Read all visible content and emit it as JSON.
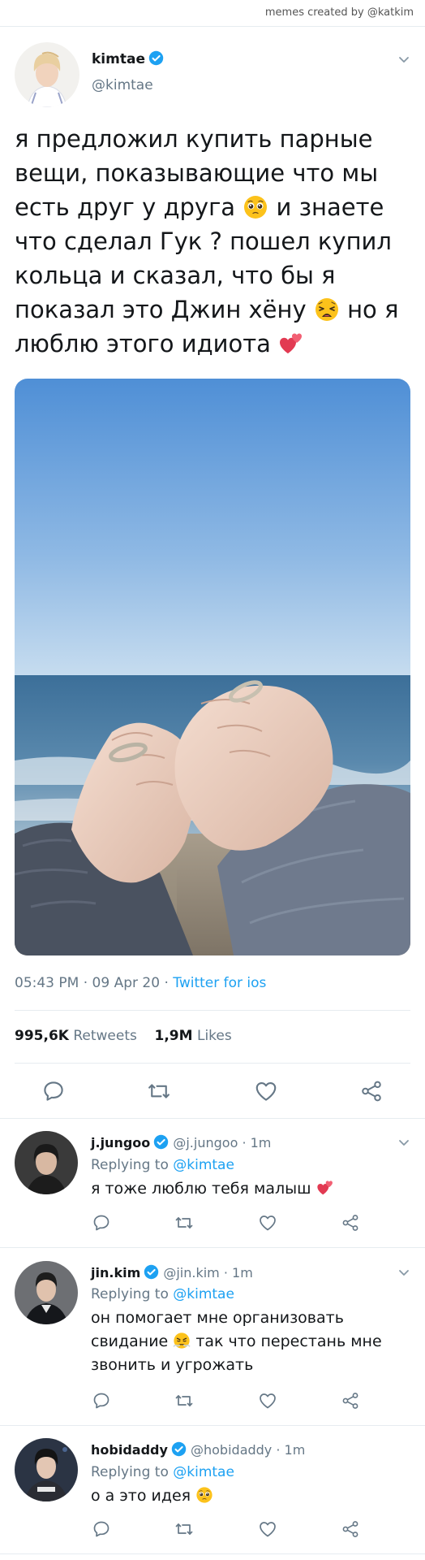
{
  "watermark": "memes created by @katkim",
  "main_tweet": {
    "name": "kimtae",
    "handle": "@kimtae",
    "text_part1": "я предложил купить парные вещи, показывающие что мы есть друг у друга",
    "text_part2": "и знаете что сделал Гук ? пошел купил кольца и сказал, что бы я показал это Джин хёну",
    "text_part3": "но я люблю этого идиота",
    "emoji_1": "pleading-face-emoji",
    "emoji_2": "weary-face-emoji",
    "emoji_3": "two-hearts-emoji",
    "time": "05:43 PM",
    "date": "09 Apr 20",
    "separator": "·",
    "source": "Twitter for ios",
    "retweets_count": "995,6K",
    "retweets_label": "Retweets",
    "likes_count": "1,9M",
    "likes_label": "Likes"
  },
  "actions": {
    "reply_icon": "speech-bubble-icon",
    "retweet_icon": "retweet-icon",
    "like_icon": "heart-icon",
    "share_icon": "share-icon"
  },
  "replies": [
    {
      "name": "j.jungoo",
      "handle": "@j.jungoo",
      "time": "· 1m",
      "verified": true,
      "replying_label": "Replying to",
      "replying_to": "@kimtae",
      "text": "я тоже люблю тебя малыш",
      "emoji": "two-hearts-emoji"
    },
    {
      "name": "jin.kim",
      "handle": "@jin.kim",
      "time": "· 1m",
      "verified": true,
      "replying_label": "Replying to",
      "replying_to": "@kimtae",
      "text_part1": "он помогает мне организовать свидание",
      "text_part2": "так что перестань мне звонить и угрожать",
      "emoji": "face-with-steam-emoji"
    },
    {
      "name": "hobidaddy",
      "handle": "@hobidaddy",
      "time": "· 1m",
      "verified": true,
      "replying_label": "Replying to",
      "replying_to": "@kimtae",
      "text": "о а это идея",
      "emoji": "pleading-face-emoji"
    }
  ],
  "colors": {
    "accent": "#1da1f2",
    "muted": "#657786",
    "text": "#14171a",
    "divider": "#e6ecf0"
  }
}
